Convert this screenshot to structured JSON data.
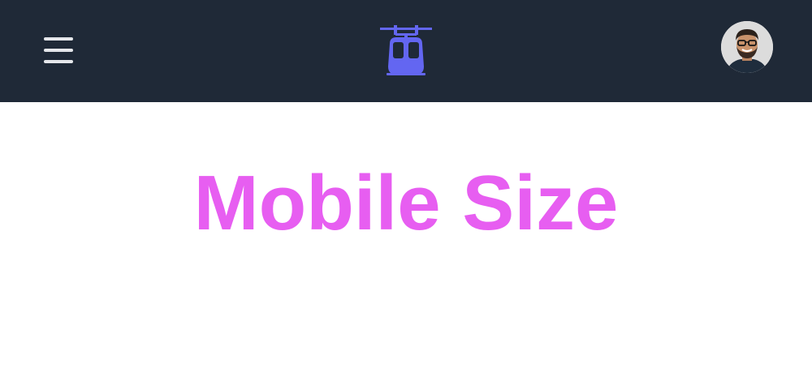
{
  "header": {
    "menu_icon": "hamburger-menu-icon",
    "logo_icon": "cable-car-icon",
    "avatar_icon": "user-avatar",
    "background_color": "#1f2937",
    "menu_color": "#e5e7eb",
    "logo_color": "#6366f1"
  },
  "main": {
    "title": "Mobile Size",
    "title_color": "#e75ef1"
  }
}
